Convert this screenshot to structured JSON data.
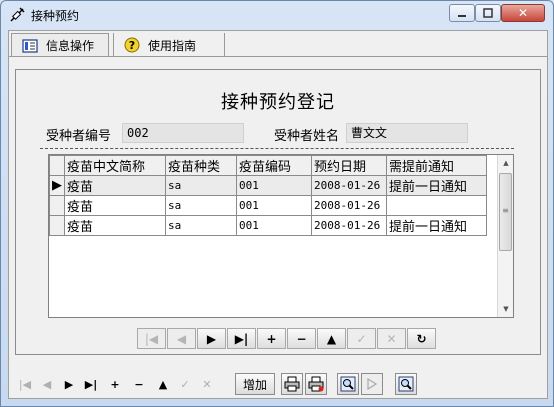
{
  "window": {
    "title": "接种预约",
    "close_glyph": "✕"
  },
  "tabs": [
    {
      "label": "信息操作",
      "icon": "form-icon",
      "active": true
    },
    {
      "label": "使用指南",
      "icon": "help-icon",
      "active": false
    }
  ],
  "form": {
    "title": "接种预约登记",
    "recipient_id_label": "受种者编号",
    "recipient_id_value": "002",
    "recipient_name_label": "受种者姓名",
    "recipient_name_value": "曹文文"
  },
  "grid": {
    "columns": [
      "疫苗中文简称",
      "疫苗种类",
      "疫苗编码",
      "预约日期",
      "需提前通知"
    ],
    "rows": [
      [
        "疫苗",
        "sa",
        "001",
        "2008-01-26",
        "提前一日通知"
      ],
      [
        "疫苗",
        "sa",
        "001",
        "2008-01-26",
        ""
      ],
      [
        "疫苗",
        "sa",
        "001",
        "2008-01-26",
        "提前一日通知"
      ]
    ],
    "selected_row": 0
  },
  "grid_nav": [
    {
      "name": "first-record-icon",
      "glyph": "|◀",
      "enabled": false
    },
    {
      "name": "prev-record-icon",
      "glyph": "◀",
      "enabled": false
    },
    {
      "name": "next-record-icon",
      "glyph": "▶",
      "enabled": true
    },
    {
      "name": "last-record-icon",
      "glyph": "▶|",
      "enabled": true
    },
    {
      "name": "insert-record-icon",
      "glyph": "+",
      "enabled": true
    },
    {
      "name": "delete-record-icon",
      "glyph": "−",
      "enabled": true
    },
    {
      "name": "edit-record-icon",
      "glyph": "▲",
      "enabled": true
    },
    {
      "name": "post-record-icon",
      "glyph": "✓",
      "enabled": false
    },
    {
      "name": "cancel-record-icon",
      "glyph": "✕",
      "enabled": false
    },
    {
      "name": "refresh-icon",
      "glyph": "↻",
      "enabled": true
    }
  ],
  "bottom_nav": [
    {
      "name": "first-record-icon",
      "glyph": "|◀",
      "enabled": false
    },
    {
      "name": "prev-record-icon",
      "glyph": "◀",
      "enabled": false
    },
    {
      "name": "next-record-icon",
      "glyph": "▶",
      "enabled": true
    },
    {
      "name": "last-record-icon",
      "glyph": "▶|",
      "enabled": true
    },
    {
      "name": "insert-record-icon",
      "glyph": "+",
      "enabled": true
    },
    {
      "name": "delete-record-icon",
      "glyph": "−",
      "enabled": true
    },
    {
      "name": "edit-record-icon",
      "glyph": "▲",
      "enabled": true
    },
    {
      "name": "post-record-icon",
      "glyph": "✓",
      "enabled": false
    },
    {
      "name": "cancel-record-icon",
      "glyph": "✕",
      "enabled": false
    }
  ],
  "toolbar": {
    "add_label": "增加"
  }
}
